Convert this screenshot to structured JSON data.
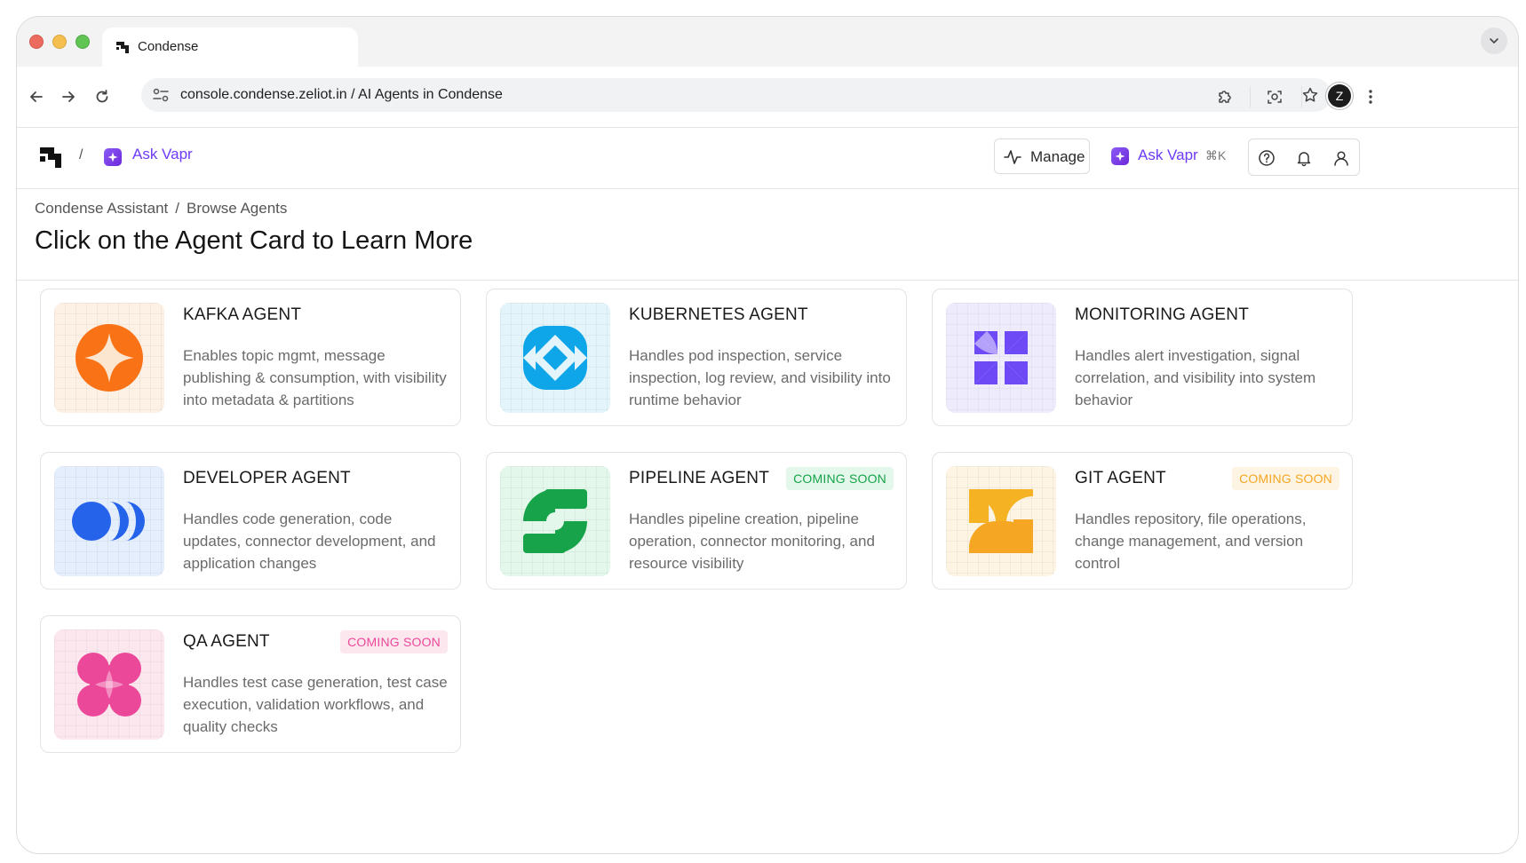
{
  "browser": {
    "tab_title": "Condense",
    "url": "console.condense.zeliot.in / AI Agents in Condense",
    "profile_initial": "Z"
  },
  "header": {
    "separator": "/",
    "ask_vapr_label": "Ask Vapr",
    "manage_label": "Manage",
    "ask_vapr_button_label": "Ask Vapr",
    "shortcut": "⌘K"
  },
  "page": {
    "breadcrumb": [
      "Condense Assistant",
      "Browse Agents"
    ],
    "breadcrumb_separator": "/",
    "title": "Click on the Agent Card to Learn More"
  },
  "agents": [
    {
      "name": "KAFKA AGENT",
      "description": "Enables topic mgmt, message publishing & consumption, with visibility into metadata & partitions",
      "badge": "",
      "icon": "orange-sparkle-icon",
      "color": "#f97316"
    },
    {
      "name": "KUBERNETES AGENT",
      "description": "Handles pod inspection, service inspection, log review, and visibility into runtime behavior",
      "badge": "",
      "icon": "blue-diamond-icon",
      "color": "#0ea5e9"
    },
    {
      "name": "MONITORING AGENT",
      "description": "Handles alert investigation, signal correlation, and visibility into system behavior",
      "badge": "",
      "icon": "purple-pinwheel-icon",
      "color": "#6d4af5"
    },
    {
      "name": "DEVELOPER AGENT",
      "description": "Handles code generation, code updates, connector development, and application changes",
      "badge": "",
      "icon": "blue-circles-icon",
      "color": "#2563eb"
    },
    {
      "name": "PIPELINE AGENT",
      "description": "Handles pipeline creation, pipeline operation, connector monitoring, and resource visibility",
      "badge": "COMING SOON",
      "icon": "green-s-icon",
      "color": "#16a34a"
    },
    {
      "name": "GIT AGENT",
      "description": "Handles repository, file operations, change management, and version control",
      "badge": "COMING SOON",
      "icon": "yellow-hourglass-icon",
      "color": "#f5a623"
    },
    {
      "name": "QA AGENT",
      "description": "Handles test case generation, test case execution, validation workflows, and quality checks",
      "badge": "COMING SOON",
      "icon": "pink-quatrefoil-icon",
      "color": "#ec4899"
    }
  ]
}
